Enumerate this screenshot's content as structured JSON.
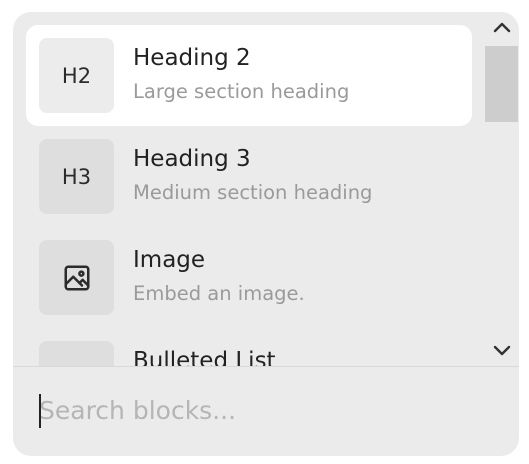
{
  "items": [
    {
      "tile_label": "H2",
      "title": "Heading 2",
      "desc": "Large section heading",
      "icon": "h2-icon"
    },
    {
      "tile_label": "H3",
      "title": "Heading 3",
      "desc": "Medium section heading",
      "icon": "h3-icon"
    },
    {
      "tile_label": "",
      "title": "Image",
      "desc": "Embed an image.",
      "icon": "image-icon"
    },
    {
      "tile_label": "",
      "title": "Bulleted List",
      "desc": "",
      "icon": "bulleted-list-icon"
    }
  ],
  "search": {
    "placeholder": "Search blocks..."
  },
  "colors": {
    "popup_bg": "#ebebeb",
    "selected_bg": "#ffffff",
    "tile_bg": "#dedede",
    "scroll_thumb": "#cdcdcd"
  }
}
